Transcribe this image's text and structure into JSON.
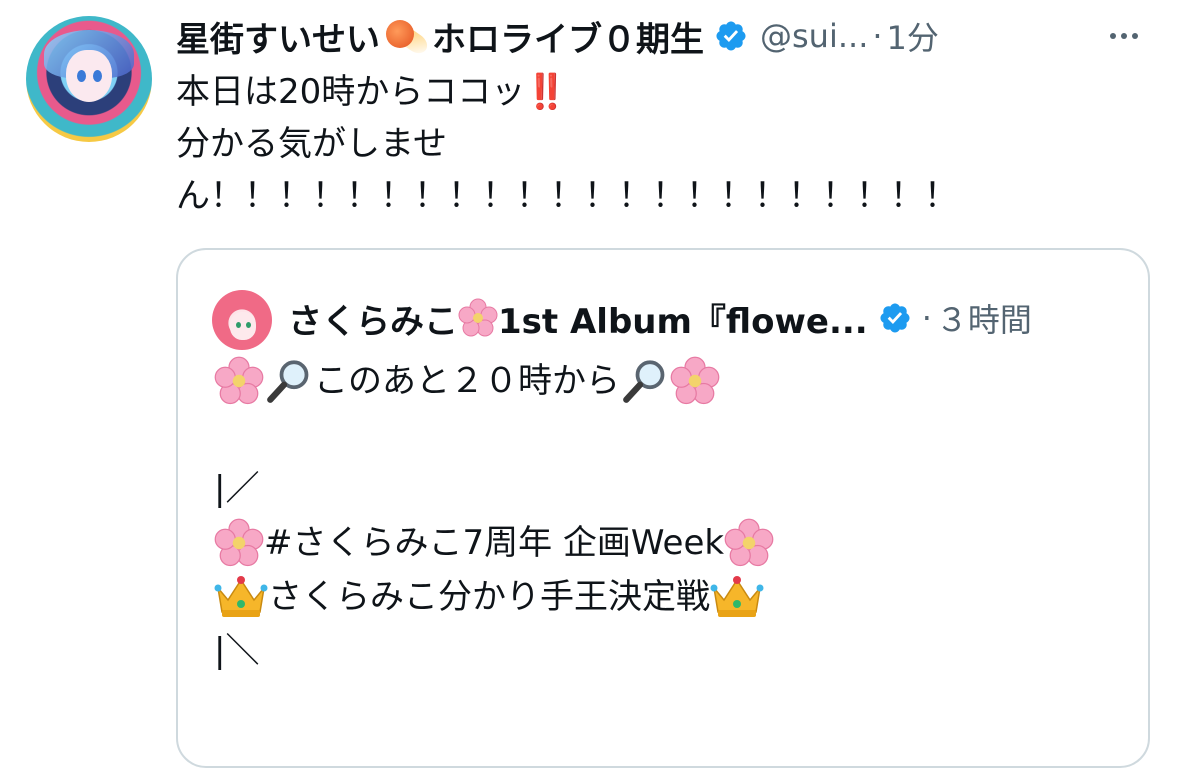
{
  "tweet": {
    "display_name": "星街すいせい",
    "display_name_suffix": "ホロライブ０期生",
    "handle": "@sui...",
    "separator": "·",
    "time": "1分",
    "text_line1": "本日は20時からココッ",
    "text_line1_emoji": "‼️",
    "text_line2": "分かる気がしませ",
    "text_line3": "ん！！！！！！！！！！！！！！！！！！！！！！",
    "icons": {
      "avatar": "avatar",
      "comet": "comet-emoji",
      "verified": "verified-badge-icon",
      "more": "more-options-icon"
    },
    "colors": {
      "text": "#0f1419",
      "muted": "#536471",
      "verified": "#1d9bf0",
      "border": "#cfd9de",
      "exclamation": "#e0212a"
    }
  },
  "quote": {
    "display_name": "さくらみこ",
    "display_name_suffix": "1st Album『flowe...",
    "separator": "·",
    "time": "３時間",
    "line1": "このあと２０時から",
    "line3": "|／",
    "line4": "#さくらみこ7周年 企画Week",
    "line5": "さくらみこ分かり手王決定戦",
    "line6": "|＼",
    "icons": {
      "sakura": "cherry-blossom-emoji",
      "magnifier": "magnifier-emoji",
      "crown": "crown-emoji"
    }
  }
}
